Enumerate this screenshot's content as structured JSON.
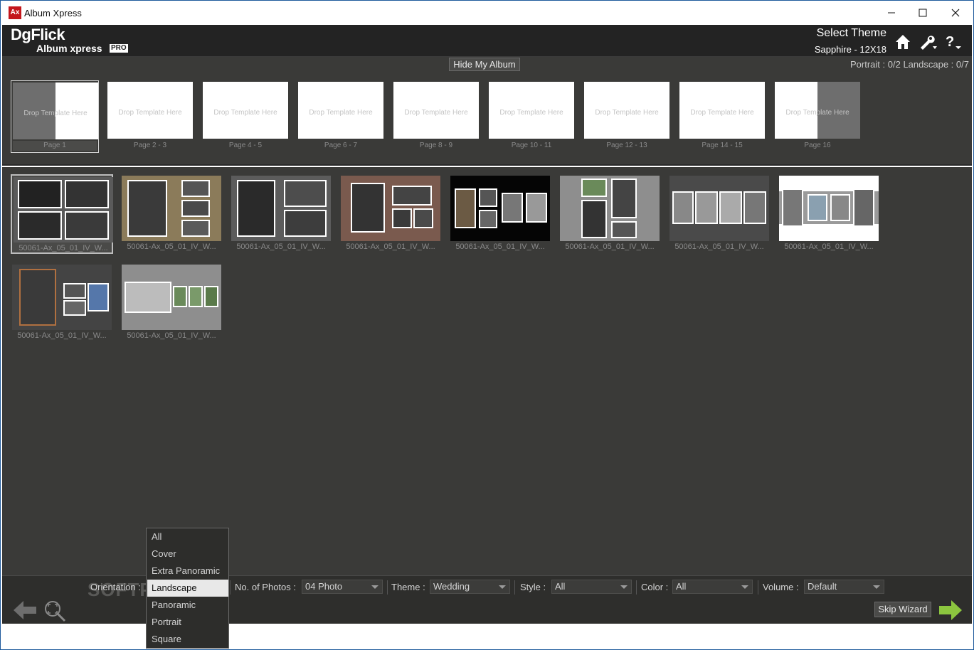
{
  "window": {
    "title": "Album Xpress",
    "icon_text": "Ax"
  },
  "header": {
    "logo_main": "DgFlick",
    "logo_sub": "Album xpress",
    "logo_badge": "PRO",
    "select_theme_label": "Select Theme",
    "theme_name": "Sapphire - 12X18"
  },
  "album": {
    "hide_button": "Hide My Album",
    "portrait_label": "Portrait :",
    "portrait_count": "0/2",
    "landscape_label": "Landscape :",
    "landscape_count": "0/7",
    "drop_text": "Drop Template Here",
    "pages": [
      "Page 1",
      "Page 2 - 3",
      "Page 4 - 5",
      "Page 6 - 7",
      "Page 8 - 9",
      "Page 10 - 11",
      "Page 12 - 13",
      "Page 14 - 15",
      "Page 16"
    ]
  },
  "templates": {
    "label": "50061-Ax_05_01_IV_W...",
    "items": [
      {
        "name": "50061-Ax_05_01_IV_W...",
        "bg": "#5a5a5a"
      },
      {
        "name": "50061-Ax_05_01_IV_W...",
        "bg": "#8b7b5a"
      },
      {
        "name": "50061-Ax_05_01_IV_W...",
        "bg": "#5c5c5c"
      },
      {
        "name": "50061-Ax_05_01_IV_W...",
        "bg": "#7a5a4e"
      },
      {
        "name": "50061-Ax_05_01_IV_W...",
        "bg": "#050505"
      },
      {
        "name": "50061-Ax_05_01_IV_W...",
        "bg": "#8e8e8e"
      },
      {
        "name": "50061-Ax_05_01_IV_W...",
        "bg": "#4a4a4a"
      },
      {
        "name": "50061-Ax_05_01_IV_W...",
        "bg": "#ffffff"
      },
      {
        "name": "50061-Ax_05_01_IV_W...",
        "bg": "#444444"
      },
      {
        "name": "50061-Ax_05_01_IV_W...",
        "bg": "#8e8e8e"
      }
    ]
  },
  "filters": {
    "orientation_label": "Orientation :",
    "photos_label": "No. of Photos :",
    "photos_value": "04 Photo",
    "theme_label": "Theme :",
    "theme_value": "Wedding",
    "style_label": "Style :",
    "style_value": "All",
    "color_label": "Color :",
    "color_value": "All",
    "volume_label": "Volume :",
    "volume_value": "Default",
    "watermark": "SOFTPEDIA"
  },
  "orientation_dropdown": {
    "options": [
      "All",
      "Cover",
      "Extra Panoramic",
      "Landscape",
      "Panoramic",
      "Portrait",
      "Square"
    ],
    "selected": "Landscape"
  },
  "nav": {
    "skip_wizard": "Skip Wizard"
  },
  "colors": {
    "panel": "#3a3a38",
    "header": "#232323",
    "accent_green": "#8cc63f",
    "brand_red": "#c4161c"
  }
}
